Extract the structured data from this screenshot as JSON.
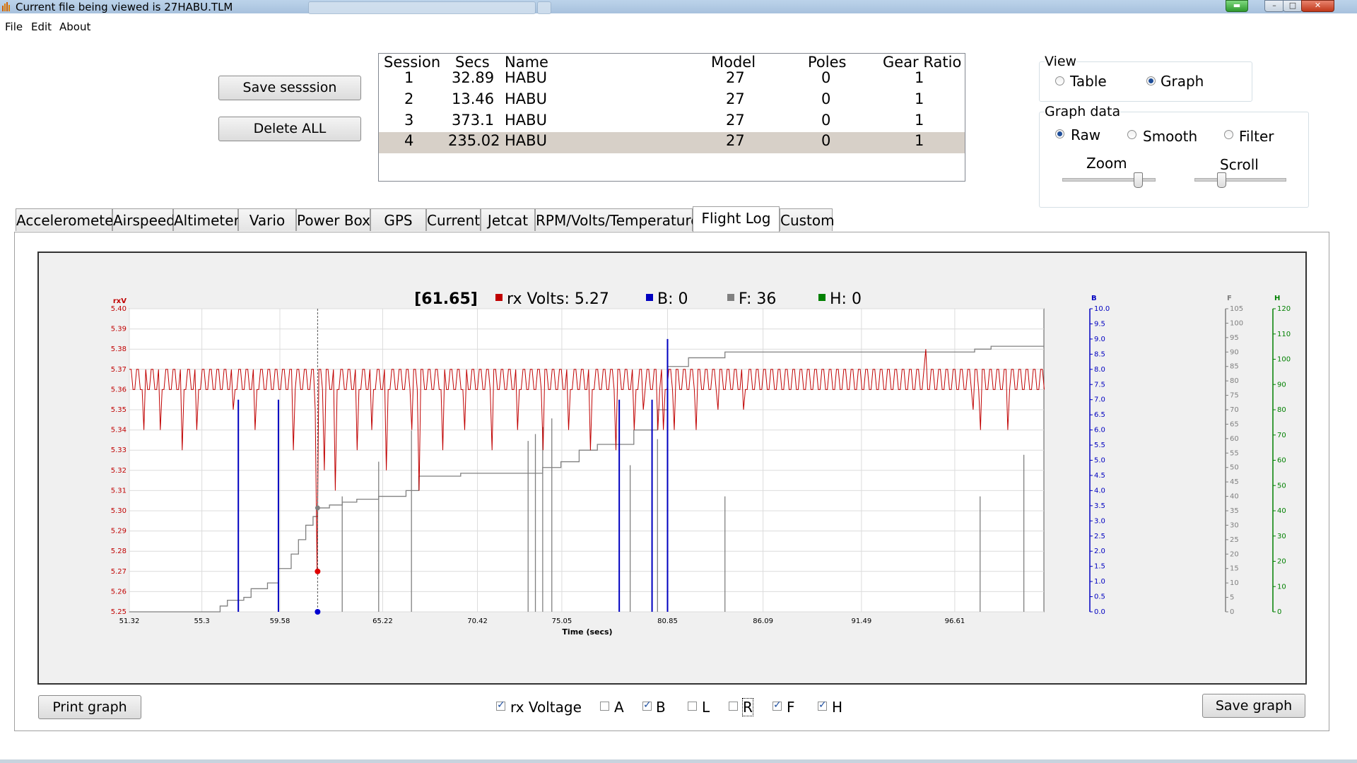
{
  "window": {
    "title": "Current file being viewed is 27HABU.TLM"
  },
  "menu": [
    "File",
    "Edit",
    "About"
  ],
  "buttons": {
    "save_session": "Save sesssion",
    "delete_all": "Delete ALL",
    "print_graph": "Print graph",
    "save_graph": "Save graph"
  },
  "sessions": {
    "columns": [
      "Session",
      "Secs",
      "Name",
      "Model",
      "Poles",
      "Gear Ratio"
    ],
    "rows": [
      [
        "1",
        "32.89",
        "HABU",
        "27",
        "0",
        "1"
      ],
      [
        "2",
        "13.46",
        "HABU",
        "27",
        "0",
        "1"
      ],
      [
        "3",
        "373.1",
        "HABU",
        "27",
        "0",
        "1"
      ],
      [
        "4",
        "235.02",
        "HABU",
        "27",
        "0",
        "1"
      ]
    ],
    "selected_row": 4
  },
  "view": {
    "label": "View",
    "options": [
      "Table",
      "Graph"
    ],
    "selected": "Graph"
  },
  "graph_data": {
    "label": "Graph data",
    "options": [
      "Raw",
      "Smooth",
      "Filter"
    ],
    "selected": "Raw",
    "zoom_label": "Zoom",
    "scroll_label": "Scroll"
  },
  "tabs": [
    "Accelerometer",
    "Airspeed",
    "Altimeter",
    "Vario",
    "Power Box",
    "GPS",
    "Current",
    "Jetcat",
    "RPM/Volts/Temperature",
    "Flight Log",
    "Custom"
  ],
  "active_tab": "Flight Log",
  "cursor": {
    "time": "[61.65]",
    "readouts": [
      {
        "text": "rx Volts: 5.27",
        "color": "#c00000"
      },
      {
        "text": "B: 0",
        "color": "#0000c0"
      },
      {
        "text": "F: 36",
        "color": "#808080"
      },
      {
        "text": "H: 0",
        "color": "#008000"
      }
    ]
  },
  "chart_data": {
    "type": "line",
    "xlabel": "Time (secs)",
    "x_ticks": [
      "51.32",
      "55.3",
      "59.58",
      "65.22",
      "70.42",
      "75.05",
      "80.85",
      "86.09",
      "91.49",
      "96.61"
    ],
    "xlim": [
      51.32,
      101.5
    ],
    "left_axis": {
      "title": "rxV",
      "ticks": [
        "5.40",
        "5.39",
        "5.38",
        "5.37",
        "5.36",
        "5.35",
        "5.34",
        "5.33",
        "5.32",
        "5.31",
        "5.30",
        "5.29",
        "5.28",
        "5.27",
        "5.26",
        "5.25"
      ],
      "ylim": [
        5.25,
        5.4
      ],
      "color": "#c00000"
    },
    "b_axis": {
      "title": "B",
      "ticks": [
        "10.0",
        "9.5",
        "9.0",
        "8.5",
        "8.0",
        "7.5",
        "7.0",
        "6.5",
        "6.0",
        "5.5",
        "5.0",
        "4.5",
        "4.0",
        "3.5",
        "3.0",
        "2.5",
        "2.0",
        "1.5",
        "1.0",
        "0.5",
        "0.0"
      ],
      "ylim": [
        0,
        10
      ],
      "color": "#0000c0"
    },
    "f_axis": {
      "title": "F",
      "ticks": [
        "105",
        "100",
        "95",
        "90",
        "85",
        "80",
        "75",
        "70",
        "65",
        "60",
        "55",
        "50",
        "45",
        "40",
        "35",
        "30",
        "25",
        "20",
        "15",
        "10",
        "5",
        "0"
      ],
      "ylim": [
        0,
        105
      ],
      "color": "#808080"
    },
    "h_axis": {
      "title": "H",
      "ticks": [
        "120",
        "110",
        "100",
        "90",
        "80",
        "70",
        "60",
        "50",
        "40",
        "30",
        "20",
        "10",
        "0"
      ],
      "ylim": [
        0,
        120
      ],
      "color": "#008000"
    },
    "series": [
      {
        "name": "rx Voltage",
        "color": "#c00000",
        "baseline": 5.36,
        "high": 5.37,
        "dips": [
          [
            52.1,
            5.34
          ],
          [
            53.0,
            5.34
          ],
          [
            54.2,
            5.33
          ],
          [
            55.0,
            5.34
          ],
          [
            57.0,
            5.35
          ],
          [
            58.2,
            5.34
          ],
          [
            60.3,
            5.33
          ],
          [
            61.5,
            5.35
          ],
          [
            61.65,
            5.27
          ],
          [
            62.0,
            5.32
          ],
          [
            62.6,
            5.31
          ],
          [
            63.8,
            5.33
          ],
          [
            64.6,
            5.34
          ],
          [
            65.4,
            5.32
          ],
          [
            66.8,
            5.34
          ],
          [
            67.2,
            5.31
          ],
          [
            68.5,
            5.33
          ],
          [
            69.7,
            5.34
          ],
          [
            71.2,
            5.33
          ],
          [
            72.6,
            5.34
          ],
          [
            74.0,
            5.33
          ],
          [
            75.4,
            5.34
          ],
          [
            76.6,
            5.33
          ],
          [
            78.0,
            5.33
          ],
          [
            79.0,
            5.34
          ],
          [
            79.5,
            5.35
          ],
          [
            80.3,
            5.34
          ],
          [
            80.6,
            5.34
          ],
          [
            81.2,
            5.34
          ],
          [
            82.4,
            5.34
          ],
          [
            83.6,
            5.35
          ],
          [
            85.0,
            5.35
          ],
          [
            97.6,
            5.35
          ],
          [
            98.0,
            5.34
          ],
          [
            99.5,
            5.34
          ]
        ],
        "spikes": [
          [
            95.0,
            5.38
          ]
        ]
      },
      {
        "name": "B",
        "color": "#0000c0",
        "spikes": [
          [
            57.3,
            7.0
          ],
          [
            59.5,
            7.0
          ],
          [
            61.65,
            0.0
          ],
          [
            78.2,
            7.0
          ],
          [
            80.0,
            7.0
          ],
          [
            80.85,
            9.0
          ]
        ]
      },
      {
        "name": "F",
        "color": "#808080",
        "steps": [
          [
            51.32,
            0
          ],
          [
            56.0,
            0
          ],
          [
            56.3,
            2
          ],
          [
            56.7,
            4
          ],
          [
            57.6,
            5
          ],
          [
            58.0,
            8
          ],
          [
            58.9,
            10
          ],
          [
            59.5,
            15
          ],
          [
            60.2,
            20
          ],
          [
            60.6,
            25
          ],
          [
            61.0,
            30
          ],
          [
            61.4,
            33
          ],
          [
            61.65,
            36
          ],
          [
            62.3,
            37
          ],
          [
            63.0,
            38
          ],
          [
            63.8,
            39
          ],
          [
            65.0,
            40
          ],
          [
            66.5,
            42
          ],
          [
            67.2,
            47
          ],
          [
            69.5,
            48
          ],
          [
            72.0,
            48
          ],
          [
            73.5,
            48
          ],
          [
            74.0,
            50
          ],
          [
            75.0,
            52
          ],
          [
            76.0,
            56
          ],
          [
            77.0,
            58
          ],
          [
            79.0,
            63
          ],
          [
            80.3,
            70
          ],
          [
            80.85,
            85
          ],
          [
            82.0,
            88
          ],
          [
            84.0,
            90
          ],
          [
            92.0,
            90
          ],
          [
            97.7,
            91
          ],
          [
            98.6,
            92
          ],
          [
            101.5,
            92
          ]
        ]
      },
      {
        "name": "H",
        "color": "#008000",
        "values": [
          0
        ]
      }
    ]
  },
  "series_toggles": [
    {
      "label": "rx Voltage",
      "checked": true
    },
    {
      "label": "A",
      "checked": false
    },
    {
      "label": "B",
      "checked": true
    },
    {
      "label": "L",
      "checked": false
    },
    {
      "label": "R",
      "checked": false
    },
    {
      "label": "F",
      "checked": true
    },
    {
      "label": "H",
      "checked": true
    }
  ]
}
